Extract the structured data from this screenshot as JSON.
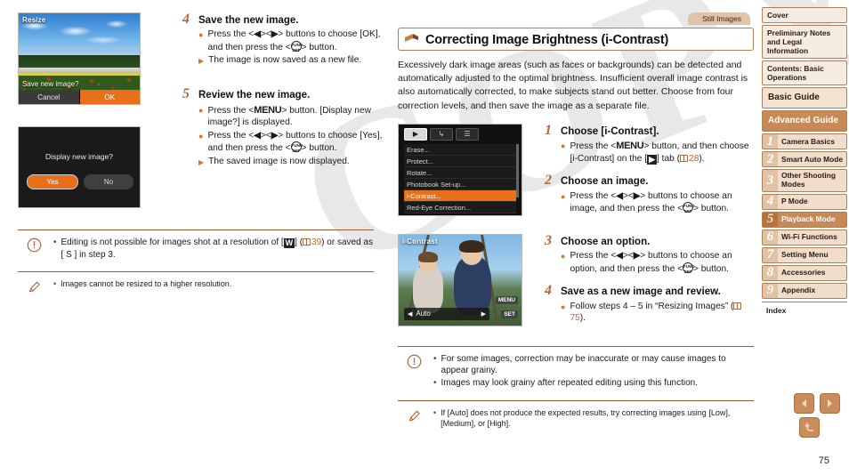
{
  "document": {
    "page_number": "75",
    "watermark": "COPY"
  },
  "left_column": {
    "screenshot_resize": {
      "label": "Resize",
      "prompt": "Save new image?",
      "buttons": [
        {
          "label": "Cancel",
          "selected": false
        },
        {
          "label": "OK",
          "selected": true
        }
      ]
    },
    "screenshot_display": {
      "prompt": "Display new image?",
      "buttons": [
        {
          "label": "Yes",
          "selected": true
        },
        {
          "label": "No",
          "selected": false
        }
      ]
    },
    "steps": [
      {
        "number": "4",
        "title": "Save the new image.",
        "bullets": [
          {
            "marker": "dot",
            "text_parts": [
              "Press the <",
              "LEFT",
              "><",
              "RIGHT",
              "> buttons to choose [OK], and then press the <",
              "FUNCSET",
              "> button."
            ]
          },
          {
            "marker": "triangle",
            "text_parts": [
              "The image is now saved as a new file."
            ]
          }
        ]
      },
      {
        "number": "5",
        "title": "Review the new image.",
        "bullets": [
          {
            "marker": "dot",
            "text_parts": [
              "Press the <",
              "MENU",
              "> button. [Display new image?] is displayed."
            ]
          },
          {
            "marker": "dot",
            "text_parts": [
              "Press the <",
              "LEFT",
              "><",
              "RIGHT",
              "> buttons to choose [Yes], and then press the <",
              "FUNCSET",
              "> button."
            ]
          },
          {
            "marker": "triangle",
            "text_parts": [
              "The saved image is now displayed."
            ]
          }
        ]
      }
    ],
    "notice": {
      "icon": "exclamation-icon",
      "lines": [
        "Editing is not possible for images shot at a resolution of [W] (☎39) or saved as [ S ] in step 3."
      ],
      "line_pre": "Editing is not possible for images shot at a resolution of [",
      "line_inv": "W",
      "line_mid": "] (",
      "line_ref": "39",
      "line_post": ") or saved as [ S ] in step 3."
    },
    "tip": {
      "icon": "pencil-icon",
      "text": "Images cannot be resized to a higher resolution."
    }
  },
  "right_column": {
    "tag": "Still Images",
    "title": "Correcting Image Brightness (i-Contrast)",
    "intro": "Excessively dark image areas (such as faces or backgrounds) can be detected and automatically adjusted to the optimal brightness. Insufficient overall image contrast is also automatically corrected, to make subjects stand out better. Choose from four correction levels, and then save the image as a separate file.",
    "screenshot_menu": {
      "tabs": [
        "▶",
        "↳",
        "☰"
      ],
      "active_tab_index": 0,
      "items": [
        {
          "label": "Erase...",
          "selected": false
        },
        {
          "label": "Protect...",
          "selected": false
        },
        {
          "label": "Rotate...",
          "selected": false
        },
        {
          "label": "Photobook Set-up...",
          "selected": false
        },
        {
          "label": "i-Contrast...",
          "selected": true
        },
        {
          "label": "Red-Eye Correction...",
          "selected": false
        }
      ]
    },
    "screenshot_icontrast": {
      "label": "i-Contrast",
      "option_value": "Auto",
      "left_arrow": "◀",
      "right_arrow": "▶",
      "hint_menu": "MENU",
      "hint_set": "SET"
    },
    "steps": [
      {
        "number": "1",
        "title": "Choose [i-Contrast].",
        "bullets": [
          {
            "marker": "dot",
            "pre": "Press the <",
            "kbd": "MENU",
            "post": "> button, and then choose [i-Contrast] on the [",
            "tabicon": "▶",
            "post2": "] tab (",
            "ref": "28",
            "post3": ")."
          }
        ]
      },
      {
        "number": "2",
        "title": "Choose an image.",
        "bullets": [
          {
            "marker": "dot",
            "text": "Press the <◀><▶> buttons to choose an image, and then press the <FUNC.SET> button."
          }
        ]
      },
      {
        "number": "3",
        "title": "Choose an option.",
        "bullets": [
          {
            "marker": "dot",
            "text": "Press the <◀><▶> buttons to choose an option, and then press the <FUNC.SET> button."
          }
        ]
      },
      {
        "number": "4",
        "title": "Save as a new image and review.",
        "bullets": [
          {
            "marker": "dot",
            "pre": "Follow steps 4 – 5 in “Resizing Images” (",
            "ref": "75",
            "post": ")."
          }
        ]
      }
    ],
    "notice": {
      "icon": "exclamation-icon",
      "lines": [
        "For some images, correction may be inaccurate or may cause images to appear grainy.",
        "Images may look grainy after repeated editing using this function."
      ]
    },
    "tip": {
      "icon": "pencil-icon",
      "text": "If [Auto] does not produce the expected results, try correcting images using [Low], [Medium], or [High]."
    }
  },
  "sidebar": {
    "top_items": [
      {
        "label": "Cover",
        "style": "plain",
        "active": false
      },
      {
        "label": "Preliminary Notes and Legal Information",
        "style": "plain",
        "active": false
      },
      {
        "label": "Contents: Basic Operations",
        "style": "plain",
        "active": false
      },
      {
        "label": "Basic Guide",
        "style": "big",
        "active": false
      },
      {
        "label": "Advanced Guide",
        "style": "big",
        "active": true
      }
    ],
    "chapters": [
      {
        "number": "1",
        "label": "Camera Basics",
        "active": false
      },
      {
        "number": "2",
        "label": "Smart Auto Mode",
        "active": false
      },
      {
        "number": "3",
        "label": "Other Shooting Modes",
        "active": false
      },
      {
        "number": "4",
        "label": "P Mode",
        "active": false
      },
      {
        "number": "5",
        "label": "Playback Mode",
        "active": true
      },
      {
        "number": "6",
        "label": "Wi-Fi Functions",
        "active": false
      },
      {
        "number": "7",
        "label": "Setting Menu",
        "active": false
      },
      {
        "number": "8",
        "label": "Accessories",
        "active": false
      },
      {
        "number": "9",
        "label": "Appendix",
        "active": false
      }
    ],
    "index_label": "Index"
  },
  "footer_nav": {
    "previous_label": "◀",
    "next_label": "▶",
    "back_label": "↩"
  },
  "colors": {
    "accent_brown": "#b3673a",
    "sidebar_fill": "#f0ddcb",
    "sidebar_active": "#c78a57",
    "highlight_orange": "#e8701a",
    "rule": "#9a5b33"
  }
}
